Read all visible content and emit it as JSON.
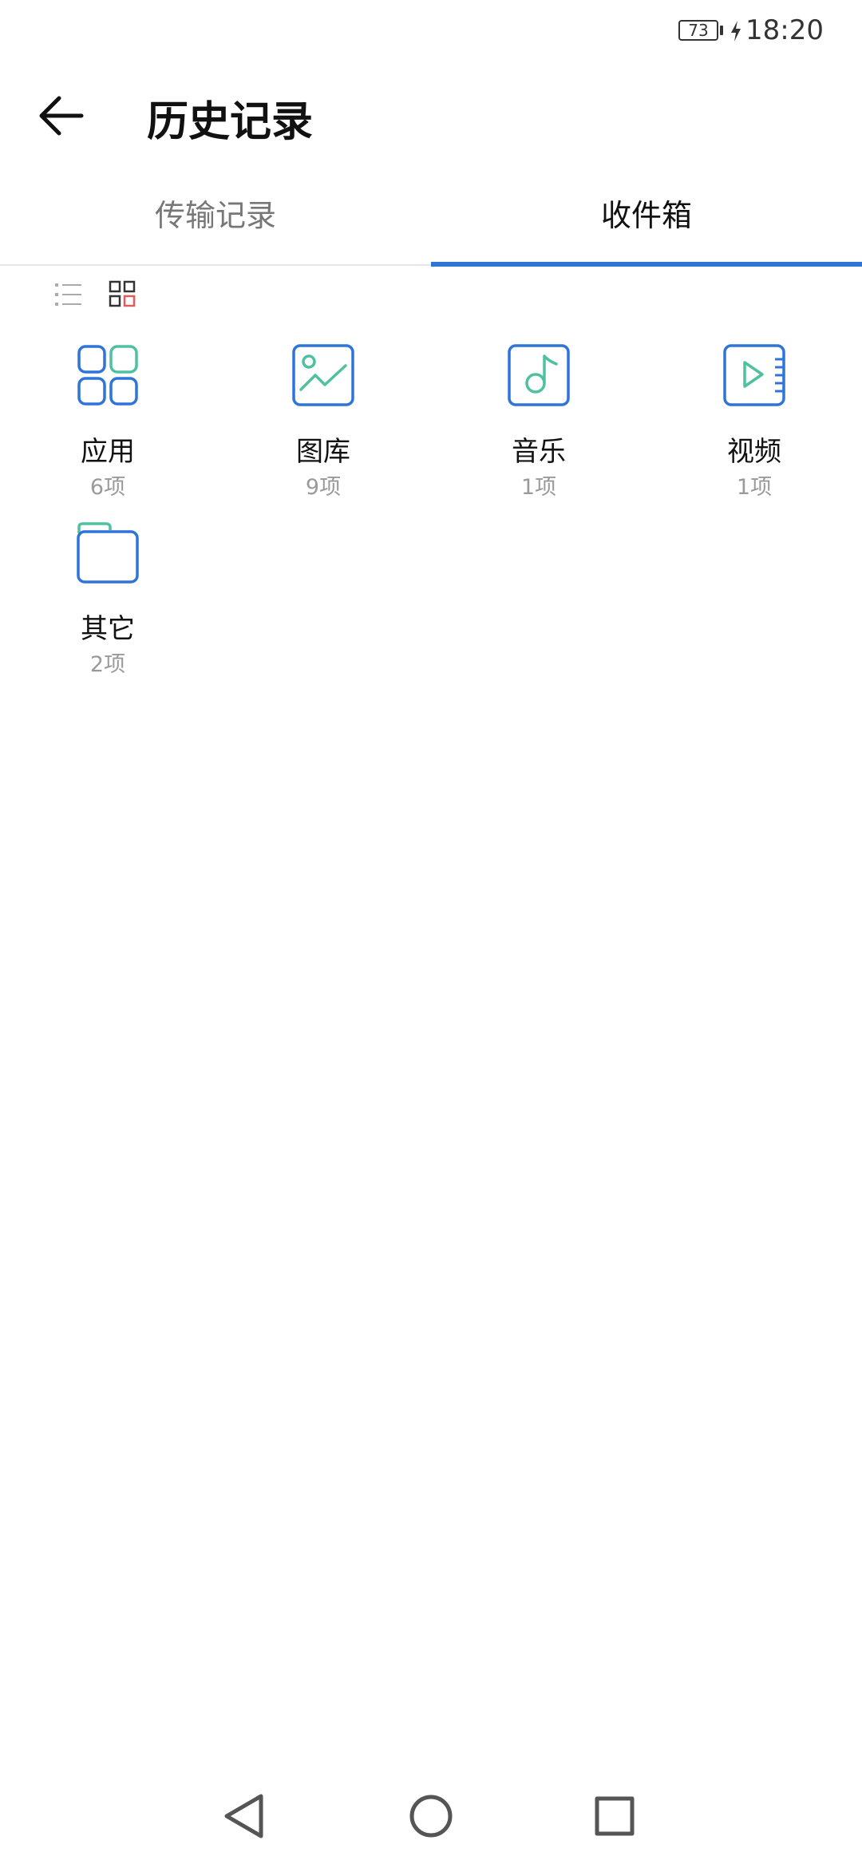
{
  "status_bar": {
    "battery_level": "73",
    "time": "18:20"
  },
  "header": {
    "title": "历史记录"
  },
  "tabs": [
    {
      "label": "传输记录",
      "active": false
    },
    {
      "label": "收件箱",
      "active": true
    }
  ],
  "view_toggle": {
    "list_icon": "list-icon",
    "grid_icon": "grid-icon",
    "selected": "grid"
  },
  "categories": [
    {
      "label": "应用",
      "count": "6项",
      "icon": "apps-icon"
    },
    {
      "label": "图库",
      "count": "9项",
      "icon": "gallery-icon"
    },
    {
      "label": "音乐",
      "count": "1项",
      "icon": "music-icon"
    },
    {
      "label": "视频",
      "count": "1项",
      "icon": "video-icon"
    },
    {
      "label": "其它",
      "count": "2项",
      "icon": "folder-icon"
    }
  ],
  "colors": {
    "accent_blue": "#2f74d9",
    "accent_green": "#4fc1a0"
  }
}
